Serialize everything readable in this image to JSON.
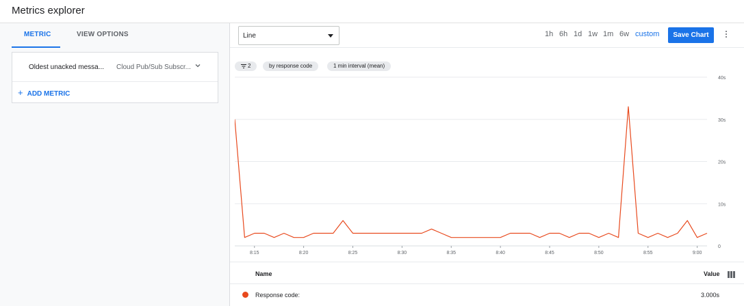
{
  "app": {
    "title": "Metrics explorer"
  },
  "left_panel": {
    "tabs": [
      {
        "label": "METRIC"
      },
      {
        "label": "VIEW OPTIONS"
      }
    ],
    "metric": {
      "name": "Oldest unacked messa...",
      "resource": "Cloud Pub/Sub Subscr..."
    },
    "add_metric_label": "ADD METRIC",
    "add_icon": "plus-icon"
  },
  "toolbar": {
    "chart_type": "Line",
    "ranges": [
      "1h",
      "6h",
      "1d",
      "1w",
      "1m",
      "6w"
    ],
    "custom_label": "custom",
    "save_label": "Save Chart"
  },
  "chips": {
    "filter_count": "2",
    "group_by": "by response code",
    "aggregation": "1 min interval (mean)"
  },
  "colors": {
    "accent": "#1a73e8",
    "series": "#e8491d",
    "grid": "#e8eaed"
  },
  "chart_data": {
    "type": "line",
    "x_tick_labels": [
      "8:15",
      "8:20",
      "8:25",
      "8:30",
      "8:35",
      "8:40",
      "8:45",
      "8:50",
      "8:55",
      "9:00"
    ],
    "y_tick_labels": [
      "0",
      "10s",
      "20s",
      "30s",
      "40s"
    ],
    "ylim": [
      0,
      40
    ],
    "x": [
      "8:13",
      "8:14",
      "8:15",
      "8:16",
      "8:17",
      "8:18",
      "8:19",
      "8:20",
      "8:21",
      "8:22",
      "8:23",
      "8:24",
      "8:25",
      "8:26",
      "8:27",
      "8:28",
      "8:29",
      "8:30",
      "8:31",
      "8:32",
      "8:33",
      "8:34",
      "8:35",
      "8:36",
      "8:37",
      "8:38",
      "8:39",
      "8:40",
      "8:41",
      "8:42",
      "8:43",
      "8:44",
      "8:45",
      "8:46",
      "8:47",
      "8:48",
      "8:49",
      "8:50",
      "8:51",
      "8:52",
      "8:53",
      "8:54",
      "8:55",
      "8:56",
      "8:57",
      "8:58",
      "8:59",
      "9:00",
      "9:01"
    ],
    "series": [
      {
        "values": [
          30,
          2,
          3,
          3,
          2,
          3,
          2,
          2,
          3,
          3,
          3,
          6,
          3,
          3,
          3,
          3,
          3,
          3,
          3,
          3,
          4,
          3,
          2,
          2,
          2,
          2,
          2,
          2,
          3,
          3,
          3,
          2,
          3,
          3,
          2,
          3,
          3,
          2,
          3,
          2,
          33,
          3,
          2,
          3,
          2,
          3,
          6,
          2,
          3
        ]
      }
    ],
    "grid": true
  },
  "legend": {
    "name_header": "Name",
    "value_header": "Value",
    "rows": [
      {
        "name": "Response code:",
        "value": "3.000s"
      }
    ]
  }
}
